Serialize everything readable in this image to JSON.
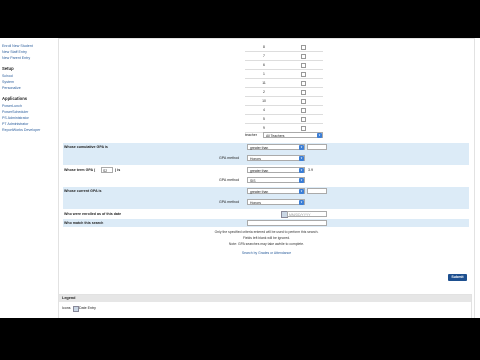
{
  "sidebar": {
    "top_items": [
      "Enroll New Student",
      "New Staff Entry",
      "New Parent Entry"
    ],
    "setup_heading": "Setup",
    "setup_items": [
      "School",
      "System",
      "Personalize"
    ],
    "apps_heading": "Applications",
    "apps_items": [
      "PowerLunch",
      "PowerScheduler",
      "PS Administrator",
      "PT Administrator",
      "ReportWorks Developer"
    ]
  },
  "grades": [
    "8",
    "7",
    "6",
    "1",
    "11",
    "2",
    "10",
    "4",
    "5",
    "9"
  ],
  "teacher": {
    "label": "teacher",
    "value": "All Teachers"
  },
  "cumulative_gpa": {
    "label": "Whose cumulative GPA is",
    "comparison": "greater than",
    "method_label": "GPA method",
    "method": "Honors",
    "value": ""
  },
  "term_gpa": {
    "label": "Whose term GPA (",
    "term_value": "S2",
    "label_suffix": ") is",
    "comparison": "greater than",
    "value": "3.9",
    "method_label": "GPA method",
    "method": "SIS"
  },
  "current_gpa": {
    "label": "Whose current GPA is",
    "comparison": "greater than",
    "method_label": "GPA method",
    "method": "Honors",
    "value": ""
  },
  "enrolled": {
    "label": "Who were enrolled as of this date",
    "date_placeholder": "MM/DD/YYYY"
  },
  "match_search": {
    "label": "Who match this search",
    "value": ""
  },
  "notes": [
    "Only the specified criteria entered will be used to perform this search.",
    "Fields left blank will be ignored.",
    "Note: GPA searches may take awhile to complete."
  ],
  "search_link": "Search by Grades or Attendance",
  "submit_label": "Submit",
  "legend": {
    "title": "Legend",
    "items_prefix": "Icons",
    "item_label": "Date Entry"
  }
}
